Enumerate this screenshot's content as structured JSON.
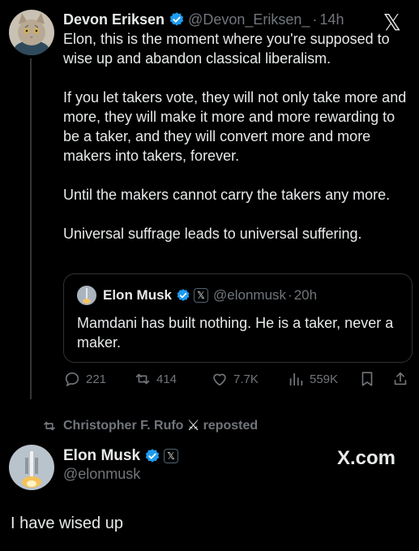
{
  "tweet": {
    "author_name": "Devon Eriksen",
    "author_handle": "@Devon_Eriksen_",
    "separator": "·",
    "time": "14h",
    "paragraphs": [
      "Elon, this is the moment where you're supposed to wise up and abandon classical liberalism.",
      "If you let takers vote, they will not only take more and more, they will make it more and more rewarding to be a taker, and they will convert more and more makers into takers, forever.",
      "Until the makers cannot carry the takers any more.",
      "Universal suffrage leads to universal suffering."
    ]
  },
  "quote": {
    "author_name": "Elon Musk",
    "author_handle": "@elonmusk",
    "separator": "·",
    "time": "20h",
    "text": "Mamdani has built nothing. He is a taker, never a maker."
  },
  "actions": {
    "replies": "221",
    "reposts": "414",
    "likes": "7.7K",
    "views": "559K"
  },
  "repost_bar": {
    "reposter": "Christopher F. Rufo",
    "label": "reposted"
  },
  "reply": {
    "author_name": "Elon Musk",
    "author_handle": "@elonmusk",
    "brand": "X.com",
    "text": "I have wised up"
  },
  "colors": {
    "background": "#000000",
    "text": "#e7e9ea",
    "muted": "#71767b",
    "verified": "#1d9bf0",
    "border": "#2f3336"
  },
  "icons": [
    "x-logo-icon",
    "verified-badge-icon",
    "reply-icon",
    "repost-icon",
    "like-icon",
    "views-icon",
    "bookmark-icon",
    "share-icon"
  ]
}
